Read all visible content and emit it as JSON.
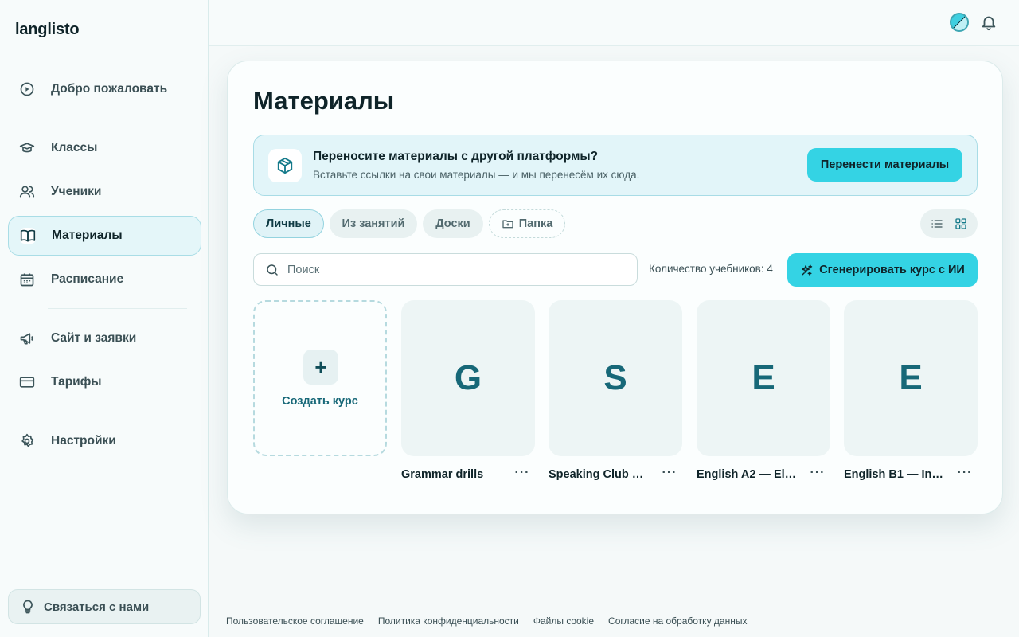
{
  "app": {
    "logo": "langlisto"
  },
  "sidebar": {
    "items": [
      {
        "label": "Добро пожаловать",
        "icon": "play-circle-icon"
      },
      {
        "label": "Классы",
        "icon": "graduation-cap-icon"
      },
      {
        "label": "Ученики",
        "icon": "users-icon"
      },
      {
        "label": "Материалы",
        "icon": "book-icon",
        "active": true
      },
      {
        "label": "Расписание",
        "icon": "calendar-icon"
      },
      {
        "label": "Сайт и заявки",
        "icon": "megaphone-icon"
      },
      {
        "label": "Тарифы",
        "icon": "credit-card-icon"
      },
      {
        "label": "Настройки",
        "icon": "gear-icon"
      }
    ],
    "contact": "Связаться с нами"
  },
  "main": {
    "title": "Материалы",
    "banner": {
      "title": "Переносите материалы с другой платформы?",
      "subtitle": "Вставьте ссылки на свои материалы — и мы перенесём их сюда.",
      "button": "Перенести материалы"
    },
    "tabs": [
      "Личные",
      "Из занятий",
      "Доски",
      "Папка"
    ],
    "search_placeholder": "Поиск",
    "count": "Количество учебников: 4",
    "generate_button": "Сгенерировать курс с ИИ",
    "create_label": "Создать курс",
    "create_plus": "+",
    "courses": [
      {
        "letter": "G",
        "title": "Grammar drills"
      },
      {
        "letter": "S",
        "title": "Speaking Club — ..."
      },
      {
        "letter": "E",
        "title": "English A2 — Ele..."
      },
      {
        "letter": "E",
        "title": "English B1 — Inte..."
      }
    ],
    "more": "···"
  },
  "footer": {
    "links": [
      "Пользовательское соглашение",
      "Политика конфиденциальности",
      "Файлы cookie",
      "Согласие на обработку данных"
    ]
  },
  "colors": {
    "accent": "#34d3e4",
    "brand_dark": "#176878"
  }
}
